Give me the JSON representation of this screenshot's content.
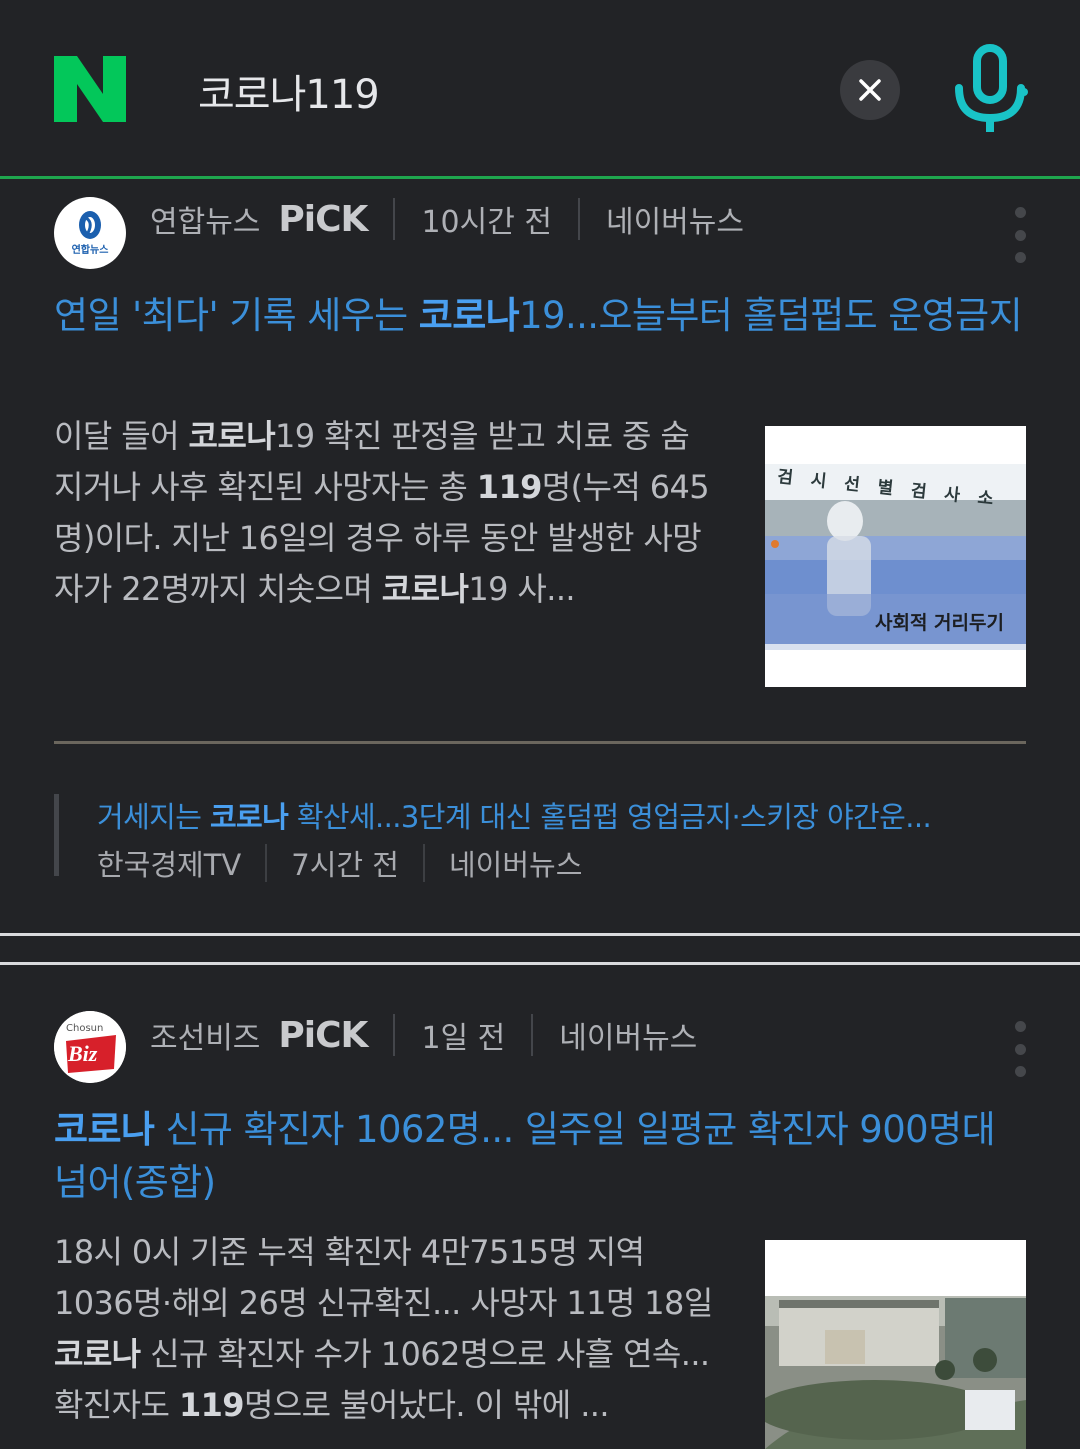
{
  "search": {
    "query": "코로나119",
    "clear_label": "×"
  },
  "icons": {
    "logo": "naver-n-logo",
    "clear": "close-icon",
    "mic": "microphone-icon",
    "more": "more-vertical-icon"
  },
  "colors": {
    "accent_green": "#03c75a",
    "link_blue": "#3b8fd9",
    "mic_teal": "#19c3c7"
  },
  "articles": [
    {
      "press": "연합뉴스",
      "pick": "PiCK",
      "time": "10시간 전",
      "source": "네이버뉴스",
      "press_logo_text": "연합뉴스",
      "headline_prefix": "연일 '최다' 기록 세우는 ",
      "headline_bold": "코로나",
      "headline_rest": "19...오늘부터 홀덤펍도 운영금지",
      "summary_a": "이달 들어 ",
      "summary_b": "코로나",
      "summary_c": "19 확진 판정을 받고 치료 중 숨지거나 사후 확진된 사망자는 총 ",
      "summary_d": "119",
      "summary_e": "명(누적 645명)이다. 지난 16일의 경우 하루 동안 발생한 사망자가 22명까지 치솟으며 ",
      "summary_f": "코로나",
      "summary_g": "19 사...",
      "thumb_sign_top": "검 시 선 별 검 사 소",
      "thumb_sign_bottom": "사회적 거리두기",
      "related": {
        "title_a": "거세지는 ",
        "title_b": "코로나",
        "title_c": " 확산세...3단계 대신 홀덤펍 영업금지·스키장 야간운...",
        "press": "한국경제TV",
        "time": "7시간 전",
        "source": "네이버뉴스"
      }
    },
    {
      "press": "조선비즈",
      "pick": "PiCK",
      "time": "1일 전",
      "source": "네이버뉴스",
      "press_logo_top": "Chosun",
      "press_logo_bottom": "Biz",
      "headline_bold": "코로나",
      "headline_rest": " 신규 확진자 1062명... 일주일 일평균 확진자 900명대 넘어(종합)",
      "summary_a": "18시 0시 기준 누적 확진자 4만7515명 지역 1036명·해외 26명 신규확진... 사망자 11명 18일 ",
      "summary_b": "코로나",
      "summary_c": " 신규 확진자 수가 1062명으로 사흘 연속... 확진자도 ",
      "summary_d": "119",
      "summary_e": "명으로 불어났다. 이 밖에 ..."
    }
  ]
}
